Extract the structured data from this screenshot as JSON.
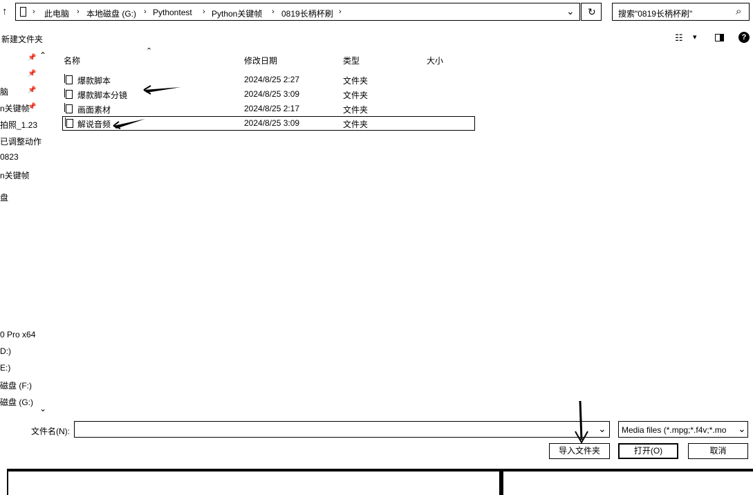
{
  "nav": {
    "up_glyph": "↑",
    "breadcrumb": [
      "此电脑",
      "本地磁盘 (G:)",
      "Pythontest",
      "Python关键帧",
      "0819长柄杯刷"
    ],
    "dropdown_glyph": "⌄",
    "refresh_glyph": "↻",
    "search_placeholder": "搜索\"0819长柄杯刷\"",
    "search_glyph": "⌕"
  },
  "toolbar": {
    "new_folder_label": "新建文件夹",
    "view_glyph": "☷",
    "view_dropdown_glyph": "▾",
    "help_glyph": "?"
  },
  "sidebar": {
    "quick_items": [
      "脑",
      "n关键帧",
      "拍照_1.23",
      "已调整动作",
      "0823",
      "n关键帧",
      "盘"
    ],
    "drive_items": [
      "0 Pro x64",
      "D:)",
      "E:)",
      "磁盘 (F:)",
      "磁盘 (G:)"
    ]
  },
  "columns": {
    "name": "名称",
    "modified": "修改日期",
    "type": "类型",
    "size": "大小"
  },
  "files": [
    {
      "name": "爆款脚本",
      "modified": "2024/8/25 2:27",
      "type": "文件夹"
    },
    {
      "name": "爆款脚本分镜",
      "modified": "2024/8/25 3:09",
      "type": "文件夹"
    },
    {
      "name": "画面素材",
      "modified": "2024/8/25 2:17",
      "type": "文件夹"
    },
    {
      "name": "解说音频",
      "modified": "2024/8/25 3:09",
      "type": "文件夹"
    }
  ],
  "footer": {
    "filename_label": "文件名(N):",
    "filename_value": "",
    "filetype_value": "Media files (*.mpg;*.f4v;*.mo",
    "import_folder_label": "导入文件夹",
    "open_label": "打开(O)",
    "cancel_label": "取消"
  }
}
